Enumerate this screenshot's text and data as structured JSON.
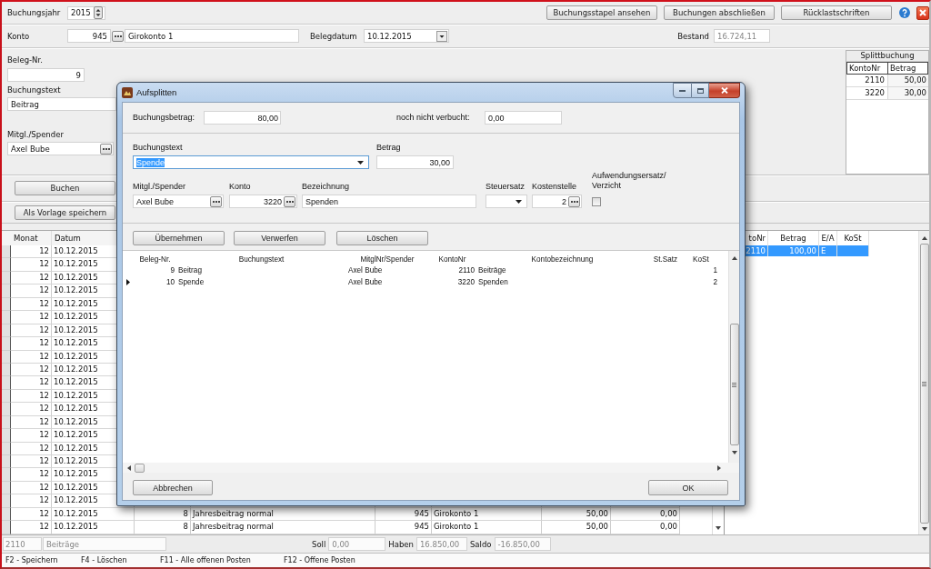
{
  "toolbar": {
    "year_label": "Buchungsjahr",
    "year": "2015",
    "buttons": [
      "Buchungsstapel ansehen",
      "Buchungen abschließen",
      "Rücklastschriften"
    ]
  },
  "account_row": {
    "konto_label": "Konto",
    "konto_nr": "945",
    "konto_name": "Girokonto 1",
    "belegdatum_label": "Belegdatum",
    "belegdatum": "10.12.2015",
    "bestand": {
      "label": "Bestand",
      "value": "16.724,11",
      "disabled": true
    }
  },
  "form": {
    "beleg_nr_label": "Beleg-Nr.",
    "beleg_nr": "9",
    "buchungstext_label": "Buchungstext",
    "buchungstext": "Beitrag",
    "spender_label": "Mitgl./Spender",
    "spender": "Axel Bube",
    "buttons": [
      "Buchen",
      "Als Vorlage speichern"
    ]
  },
  "split_panel": {
    "title": "Splittbuchung",
    "columns": [
      "KontoNr",
      "Betrag"
    ],
    "rows": [
      {
        "konto_nr": "2110",
        "betrag": "50,00"
      },
      {
        "konto_nr": "3220",
        "betrag": "30,00"
      }
    ]
  },
  "bookings_table": {
    "columns": [
      "Monat",
      "Datum"
    ],
    "rows": [
      {
        "monat": "12",
        "datum": "10.12.2015"
      },
      {
        "monat": "12",
        "datum": "10.12.2015"
      },
      {
        "monat": "12",
        "datum": "10.12.2015"
      },
      {
        "monat": "12",
        "datum": "10.12.2015"
      },
      {
        "monat": "12",
        "datum": "10.12.2015"
      },
      {
        "monat": "12",
        "datum": "10.12.2015"
      },
      {
        "monat": "12",
        "datum": "10.12.2015"
      },
      {
        "monat": "12",
        "datum": "10.12.2015"
      },
      {
        "monat": "12",
        "datum": "10.12.2015"
      },
      {
        "monat": "12",
        "datum": "10.12.2015"
      },
      {
        "monat": "12",
        "datum": "10.12.2015"
      },
      {
        "monat": "12",
        "datum": "10.12.2015"
      },
      {
        "monat": "12",
        "datum": "10.12.2015"
      },
      {
        "monat": "12",
        "datum": "10.12.2015"
      },
      {
        "monat": "12",
        "datum": "10.12.2015"
      },
      {
        "monat": "12",
        "datum": "10.12.2015"
      },
      {
        "monat": "12",
        "datum": "10.12.2015"
      },
      {
        "monat": "12",
        "datum": "10.12.2015"
      },
      {
        "monat": "12",
        "datum": "10.12.2015"
      },
      {
        "monat": "12",
        "datum": "10.12.2015"
      },
      {
        "monat": "12",
        "datum": "10.12.2015",
        "column_3": "8",
        "column_4": "Jahresbeitrag normal",
        "column_5": "945",
        "column_6": "Girokonto 1",
        "column_7": "50,00",
        "column_8": "0,00"
      },
      {
        "monat": "12",
        "datum": "10.12.2015",
        "column_3": "8",
        "column_4": "Jahresbeitrag normal",
        "column_5": "945",
        "column_6": "Girokonto 1",
        "column_7": "50,00",
        "column_8": "0,00"
      }
    ]
  },
  "detail_table": {
    "columns": [
      "toNr",
      "Betrag",
      "E/A",
      "KoSt"
    ],
    "rows": [
      {
        "konto_nr": "2110",
        "betrag": "100,00",
        "e_a": "E",
        "selected": true
      }
    ]
  },
  "summary_bar": {
    "fields": [
      {
        "value": "2110",
        "disabled": true
      },
      {
        "value": "Beiträge",
        "disabled": true
      },
      {
        "label": "Soll",
        "value": "0,00",
        "disabled": true
      },
      {
        "label": "Haben",
        "value": "16.850,00",
        "disabled": true
      },
      {
        "label": "Saldo",
        "value": "-16.850,00",
        "disabled": true
      }
    ]
  },
  "status_bar": [
    "F2 - Speichern",
    "F4 - Löschen",
    "F11 - Alle offenen Posten",
    "F12 - Offene Posten"
  ],
  "dialog": {
    "title": "Aufsplitten",
    "buchungsbetrag": {
      "label": "Buchungsbetrag:",
      "value": "80,00"
    },
    "unbooked": {
      "label": "noch nicht verbucht:",
      "value": "0,00"
    },
    "split_fields": [
      {
        "label": "Buchungstext",
        "value": "Spende",
        "kind": "select",
        "focused": true
      },
      {
        "label": "Betrag",
        "value": "30,00",
        "kind": "amount",
        "focused": false
      }
    ],
    "detail_fields": [
      {
        "label": "Mitgl./Spender",
        "value": "Axel Bube",
        "kind": "picker"
      },
      {
        "label": "Konto",
        "value": "3220",
        "kind": "code"
      },
      {
        "label": "Bezeichnung",
        "value": "Spenden",
        "kind": "text"
      },
      {
        "label": "Steuersatz",
        "kind": "select"
      },
      {
        "label": "Kostenstelle",
        "value": "2",
        "kind": "code"
      }
    ],
    "checkbox": {
      "label": "Aufwendungsersatz/ Verzicht",
      "checked": false
    },
    "action_buttons": [
      "Übernehmen",
      "Verwerfen",
      "Löschen"
    ],
    "grid": {
      "columns": [
        "Beleg-Nr.",
        "Buchungstext",
        "MitglNr/Spender",
        "KontoNr",
        "Kontobezeichnung",
        "St.Satz",
        "KoSt"
      ],
      "rows": [
        {
          "beleg_nr": "9",
          "buchungstext": "Beitrag",
          "spender": "Axel Bube",
          "konto_nr": "2110",
          "kontobezeichnung": "Beiträge",
          "kost": "1",
          "selected": false
        },
        {
          "beleg_nr": "10",
          "buchungstext": "Spende",
          "spender": "Axel Bube",
          "konto_nr": "3220",
          "kontobezeichnung": "Spenden",
          "kost": "2",
          "selected": true
        }
      ]
    },
    "footer_buttons": [
      "Abbrechen",
      "OK"
    ]
  }
}
